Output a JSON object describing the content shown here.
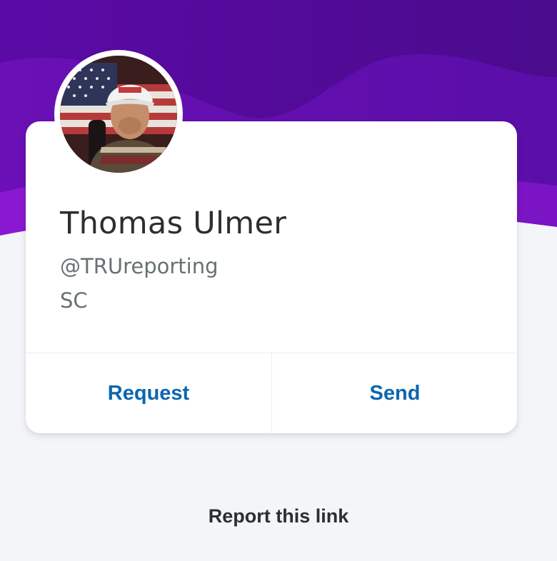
{
  "profile": {
    "name": "Thomas Ulmer",
    "handle": "@TRUreporting",
    "location": "SC"
  },
  "actions": {
    "request_label": "Request",
    "send_label": "Send"
  },
  "footer": {
    "report_label": "Report this link"
  },
  "colors": {
    "hero_purple_dark": "#4a0a8f",
    "hero_purple_mid": "#6a0fb8",
    "hero_purple_light": "#8e1ad0",
    "action_blue": "#0c66b0",
    "page_bg": "#f3f5f8"
  }
}
